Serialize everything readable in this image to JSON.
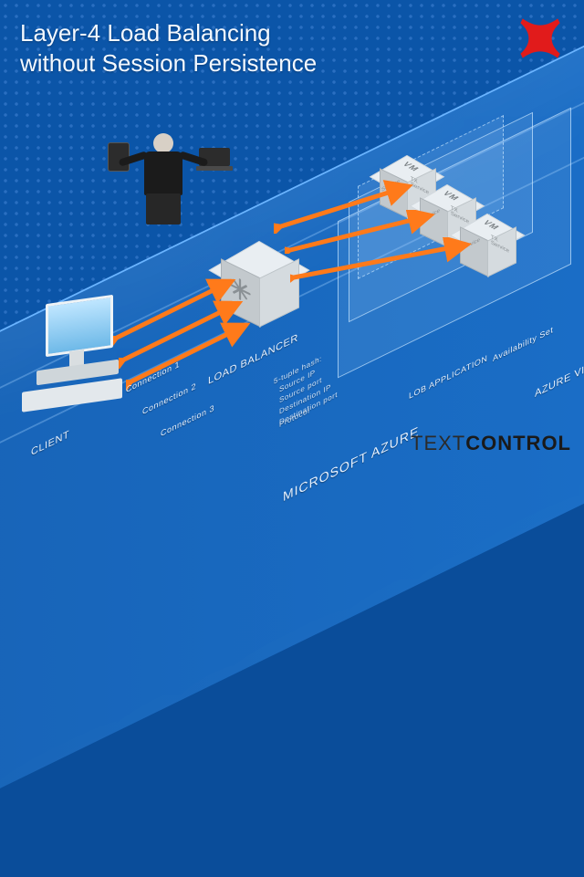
{
  "title": "Layer-4 Load Balancing\nwithout Session Persistence",
  "status_marker": "not-supported",
  "brand": {
    "light": "TEXT",
    "bold": "CONTROL"
  },
  "regions": {
    "cloud": "MICROSOFT AZURE",
    "vnet": "AZURE VIRTUAL\nNETWORK",
    "lob_app": "LOB APPLICATION",
    "availability_set": "Availability Set"
  },
  "nodes": {
    "client": "CLIENT",
    "load_balancer": "LOAD BALANCER",
    "lb_algo_title": "5-tuple hash:",
    "lb_algo_items": [
      "Source IP",
      "Source port",
      "Destination IP",
      "Destination port",
      "Protocol"
    ],
    "vm_label": "VM",
    "vm_face": {
      "left": "Service",
      "right": "TX\nService"
    }
  },
  "connections": [
    "Connection 1",
    "Connection 2",
    "Connection 3"
  ],
  "arrow_color_bi": "#ff7a1a",
  "vm_count": 3
}
